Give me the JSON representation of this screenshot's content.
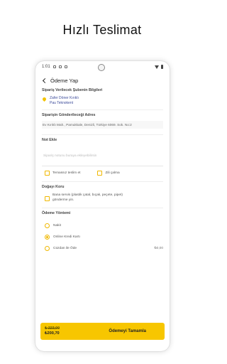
{
  "headline": "Hızlı Teslimat",
  "status_bar": {
    "time": "1:01"
  },
  "appbar": {
    "title": "Ödeme Yap"
  },
  "branch_section": {
    "title": "Sipariş Verilecek Şubenin Bilgileri",
    "name": "Zafer Döner Kırıklı",
    "sub": "Pau Teknokent"
  },
  "address_section": {
    "title": "Siparişin Gönderileceği Adres",
    "address": "Ev Kırıklı Mah., Pamukkale, Denizli, Türkiye 6069. Sok. No:2"
  },
  "notes_section": {
    "title": "Not Ekle",
    "placeholder": "Sipariş notunu buraya ekleyebilirsin",
    "options": [
      "Temassız teslim et",
      "Zili çalma"
    ]
  },
  "nature_section": {
    "title": "Doğayı Koru",
    "text_line1": "Bana servis (plastik çatal, bıçak, peçete, pipet)",
    "text_line2": "gönderme yin."
  },
  "payment_section": {
    "title": "Ödeme Yöntemi",
    "methods": [
      {
        "label": "Nakit",
        "selected": false,
        "amount": ""
      },
      {
        "label": "Online Kredi Kartı",
        "selected": true,
        "amount": ""
      },
      {
        "label": "Cüzdan ile Öde",
        "selected": false,
        "amount": "₺0,00"
      }
    ]
  },
  "bottom_bar": {
    "old_price": "₺ 223,00",
    "new_price": "₺200,70",
    "button_label": "Ödemeyi Tamamla"
  },
  "colors": {
    "accent": "#f7c600",
    "link": "#3c4b9a"
  }
}
